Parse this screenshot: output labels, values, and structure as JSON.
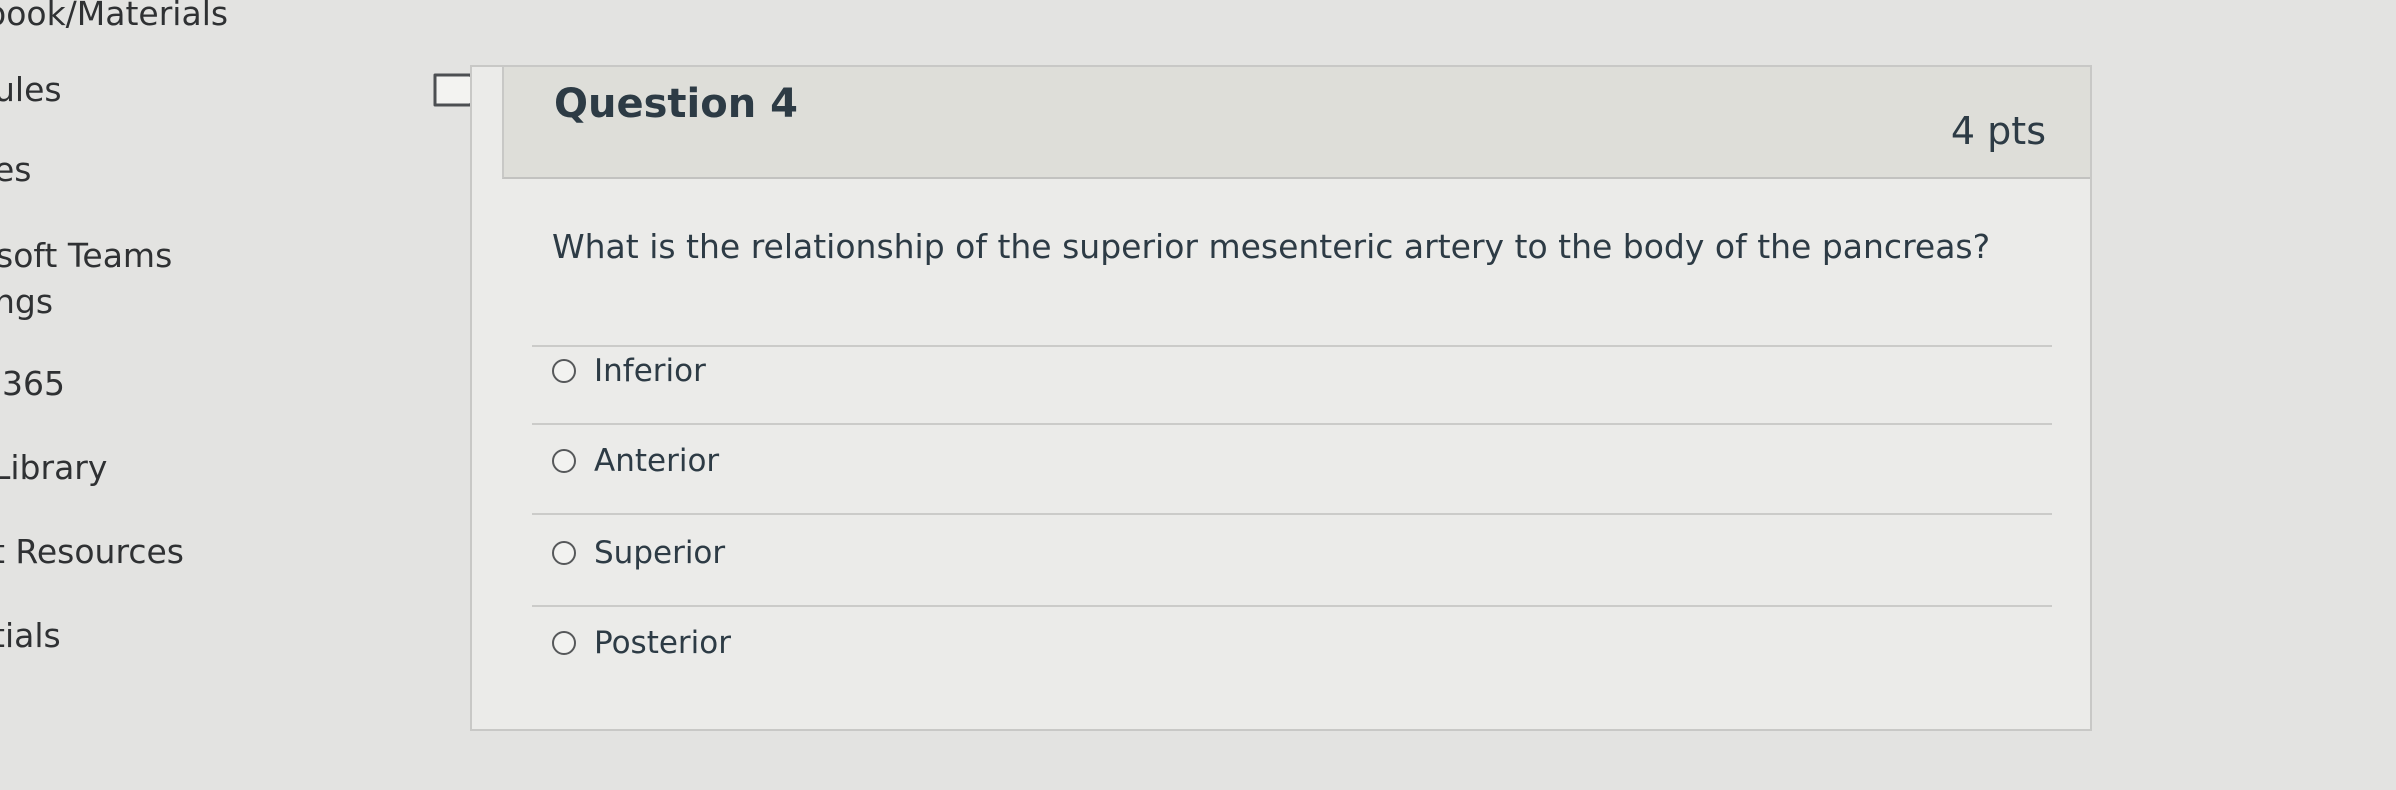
{
  "sidebar": {
    "items": [
      {
        "label": "oook/Materials"
      },
      {
        "label": "ules"
      },
      {
        "label": "es"
      },
      {
        "label": "soft Teams"
      },
      {
        "label": "ngs"
      },
      {
        "label": "365"
      },
      {
        "label": "Library"
      },
      {
        "label": "t Resources"
      },
      {
        "label": "tials"
      }
    ]
  },
  "question": {
    "title": "Question 4",
    "points": "4 pts",
    "text": "What is the relationship of the superior mesenteric artery to the body of the pancreas?",
    "answers": [
      {
        "label": "Inferior",
        "selected": false
      },
      {
        "label": "Anterior",
        "selected": false
      },
      {
        "label": "Superior",
        "selected": false
      },
      {
        "label": "Posterior",
        "selected": false
      }
    ]
  },
  "icons": {
    "flag": "bookmark-flag-icon",
    "radio": "radio-button-unchecked"
  }
}
